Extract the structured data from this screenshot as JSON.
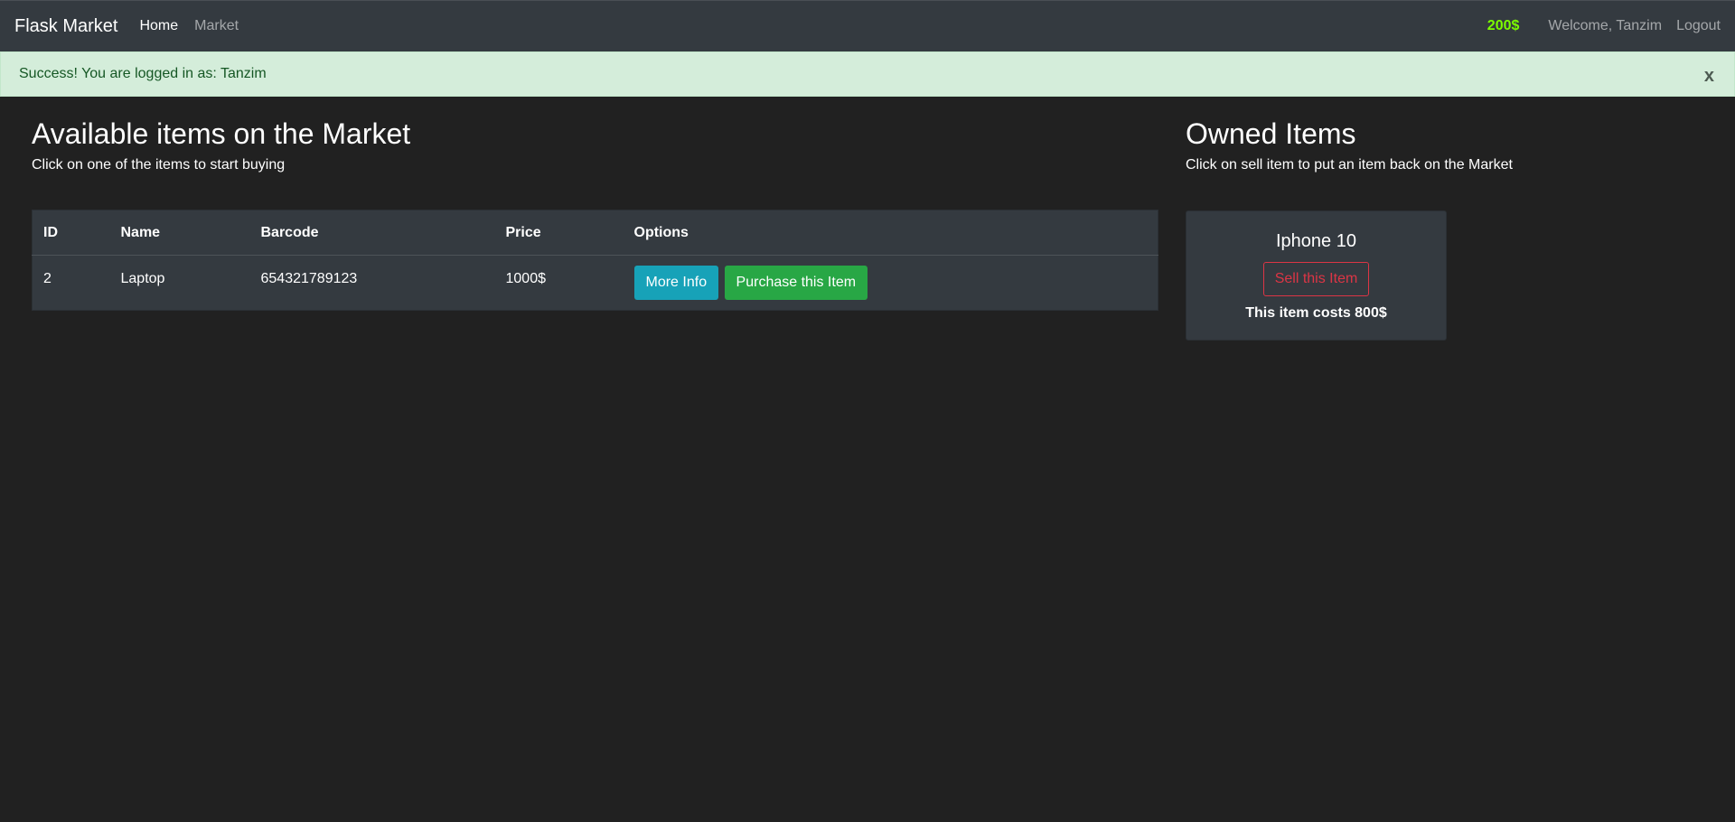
{
  "navbar": {
    "brand": "Flask Market",
    "links": [
      {
        "label": "Home",
        "active": true
      },
      {
        "label": "Market",
        "active": false
      }
    ],
    "budget": "200$",
    "welcome": "Welcome, Tanzim",
    "logout": "Logout"
  },
  "alert": {
    "message": "Success! You are logged in as: Tanzim",
    "close": "x"
  },
  "market": {
    "title": "Available items on the Market",
    "subtitle": "Click on one of the items to start buying",
    "columns": [
      "ID",
      "Name",
      "Barcode",
      "Price",
      "Options"
    ],
    "rows": [
      {
        "id": "2",
        "name": "Laptop",
        "barcode": "654321789123",
        "price": "1000$",
        "more_info": "More Info",
        "purchase": "Purchase this Item"
      }
    ]
  },
  "owned": {
    "title": "Owned Items",
    "subtitle": "Click on sell item to put an item back on the Market",
    "items": [
      {
        "name": "Iphone 10",
        "sell": "Sell this Item",
        "cost": "This item costs 800$"
      }
    ]
  },
  "colors": {
    "background": "#212121",
    "navbar": "#343a40",
    "budget": "#7cfc00",
    "success": "#28a745",
    "info": "#17a2b8",
    "danger": "#dc3545"
  }
}
